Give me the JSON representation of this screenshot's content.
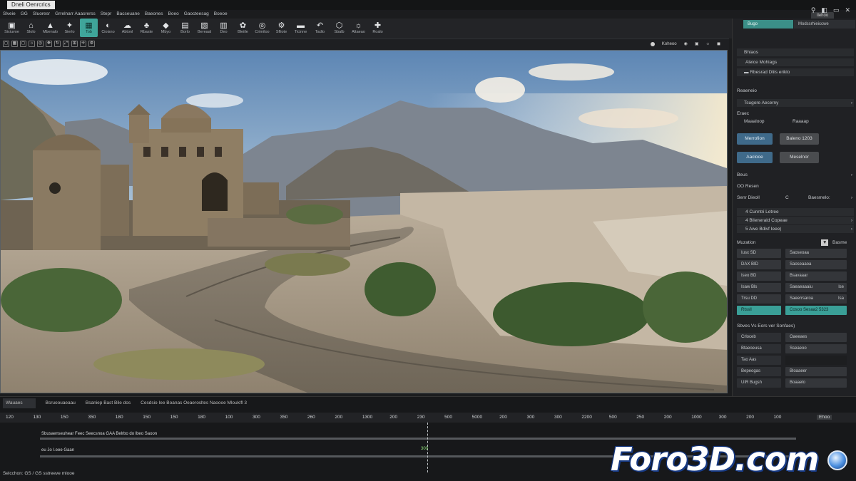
{
  "window": {
    "title": "Dneli Oenrcrics",
    "control_label": "Ilehoo"
  },
  "menu": [
    "Slveie",
    "GG",
    "Sluoresr",
    "Grrelnarr Aaasrerss",
    "Stepr",
    "Bacseuane",
    "Baeones",
    "Boeo",
    "Gaocteesag",
    "Boeoe"
  ],
  "toolbar": {
    "tools": [
      {
        "icon": "▣",
        "label": "Sixiuvoe",
        "name": "tool-select"
      },
      {
        "icon": "⌂",
        "label": "Slolo",
        "name": "tool-home"
      },
      {
        "icon": "▲",
        "label": "Mbenalo",
        "name": "tool-terrain"
      },
      {
        "icon": "✦",
        "label": "Sierlo",
        "name": "tool-sculpt"
      },
      {
        "icon": "▦",
        "label": "Tob",
        "name": "tool-grid"
      },
      {
        "icon": "◐",
        "label": "Cioisno",
        "name": "tool-shade"
      },
      {
        "icon": "☁",
        "label": "Abtonl",
        "name": "tool-sky"
      },
      {
        "icon": "♣",
        "label": "Rbaste",
        "name": "tool-foliage"
      },
      {
        "icon": "◆",
        "label": "Mbyo",
        "name": "tool-material"
      },
      {
        "icon": "▤",
        "label": "Borlo",
        "name": "tool-layers"
      },
      {
        "icon": "▧",
        "label": "Bereaal",
        "name": "tool-texture"
      },
      {
        "icon": "▥",
        "label": "Deo",
        "name": "tool-paint"
      },
      {
        "icon": "✿",
        "label": "Bleiile",
        "name": "tool-scatter"
      },
      {
        "icon": "◎",
        "label": "Crimiloo",
        "name": "tool-camera"
      },
      {
        "icon": "⚙",
        "label": "Sfliote",
        "name": "tool-settings"
      },
      {
        "icon": "▬",
        "label": "Ticinne",
        "name": "tool-timeline"
      },
      {
        "icon": "↶",
        "label": "Tadlo",
        "name": "tool-undo"
      },
      {
        "icon": "⬡",
        "label": "Sbalb",
        "name": "tool-object"
      },
      {
        "icon": "☼",
        "label": "Altaeao",
        "name": "tool-light"
      },
      {
        "icon": "✚",
        "label": "Roalo",
        "name": "tool-render"
      }
    ],
    "right_icons": [
      "⚲",
      "◧",
      "▭",
      "✕"
    ]
  },
  "viewport_bar": {
    "right_label": "Koheoo"
  },
  "panel": {
    "tab_active": "Bugo",
    "tab_other": "Modssrhieiccwe",
    "header": "Bhlaos",
    "item1": "Aleice Mohiags",
    "item2": "Rbesrad Dliis eriklo",
    "section1": "Reaeneio",
    "dropdown1": "Tsugore Aecerny",
    "label_eraec": "Eraec",
    "label_maaaloop": "Maaaloop",
    "label_raaaap": "Raaaap",
    "btn_merrofion": "Merrofion",
    "btn_baleno": "Baleno 1203",
    "btn_aaclooe": "Aaclooe",
    "btn_meselnor": "Meselnor",
    "section_beus": "Beus",
    "od_resen": "OO Resen",
    "sen_dieoll": "Senr Dieoll",
    "sen_c": "C",
    "sen_baesmelo": "Baesmelo:",
    "list": [
      "4 Cunntri Letree",
      "4 Bllenerald Copeae",
      "5 Awe Bdivf Ieee)"
    ],
    "section_muzation": "Muzation",
    "muz_right": "Basme",
    "grid": [
      [
        "Iusx SD",
        "Saoseoaa"
      ],
      [
        "DAX BID",
        "Saoseaaoa"
      ],
      [
        "Iseo BD",
        "Bsavaaar"
      ],
      [
        "Isaw Bls",
        "Saeaeaaaiu"
      ],
      [
        "Trsu DD",
        "Saeerrsaroa"
      ],
      [
        "Rtssll",
        "Cosoo Sesaa2 5323"
      ]
    ],
    "grid_suffix": [
      "",
      "",
      "",
      "lse",
      "Isa",
      ""
    ],
    "section_sbves": "Sbves Vs Eors ver Sonfaes)",
    "fields": [
      {
        "label": "Crloceb",
        "value": "Oaeeaes"
      },
      {
        "label": "Btaeoeusa",
        "value": "Sseaeoo"
      },
      {
        "label": "Tao Aas",
        "value": ""
      },
      {
        "label": "Bepeogas",
        "value": "Bloaaeer"
      },
      {
        "label": "UIR Bugsh",
        "value": "Boaaelo"
      }
    ]
  },
  "timeline": {
    "tabs": [
      "Wauaes",
      "Bsruoouaeaau",
      "Bsaniep Bast Bile dos",
      "Cesdsio Iee Boanas Oeaerosltes Naoooe Mlouklfl 3"
    ],
    "ticks": [
      "120",
      "130",
      "150",
      "350",
      "180",
      "150",
      "150",
      "180",
      "100",
      "300",
      "350",
      "260",
      "200",
      "1300",
      "200",
      "230",
      "500",
      "5000",
      "200",
      "300",
      "300",
      "2200",
      "500",
      "250",
      "200",
      "1000",
      "300",
      "200",
      "100"
    ],
    "end_tag": "Ehoo",
    "track1_label": "Sbusaenseuhear    Feec  Seecsnoa     GAA  Belrbo do     lbeo Saoon",
    "track2_label": "eu   Jo            I.eee    Gaan",
    "playhead_label": "300",
    "status": "Selcchon: GS / GS sstreeve mlooe"
  },
  "watermark": "Foro3D.com"
}
